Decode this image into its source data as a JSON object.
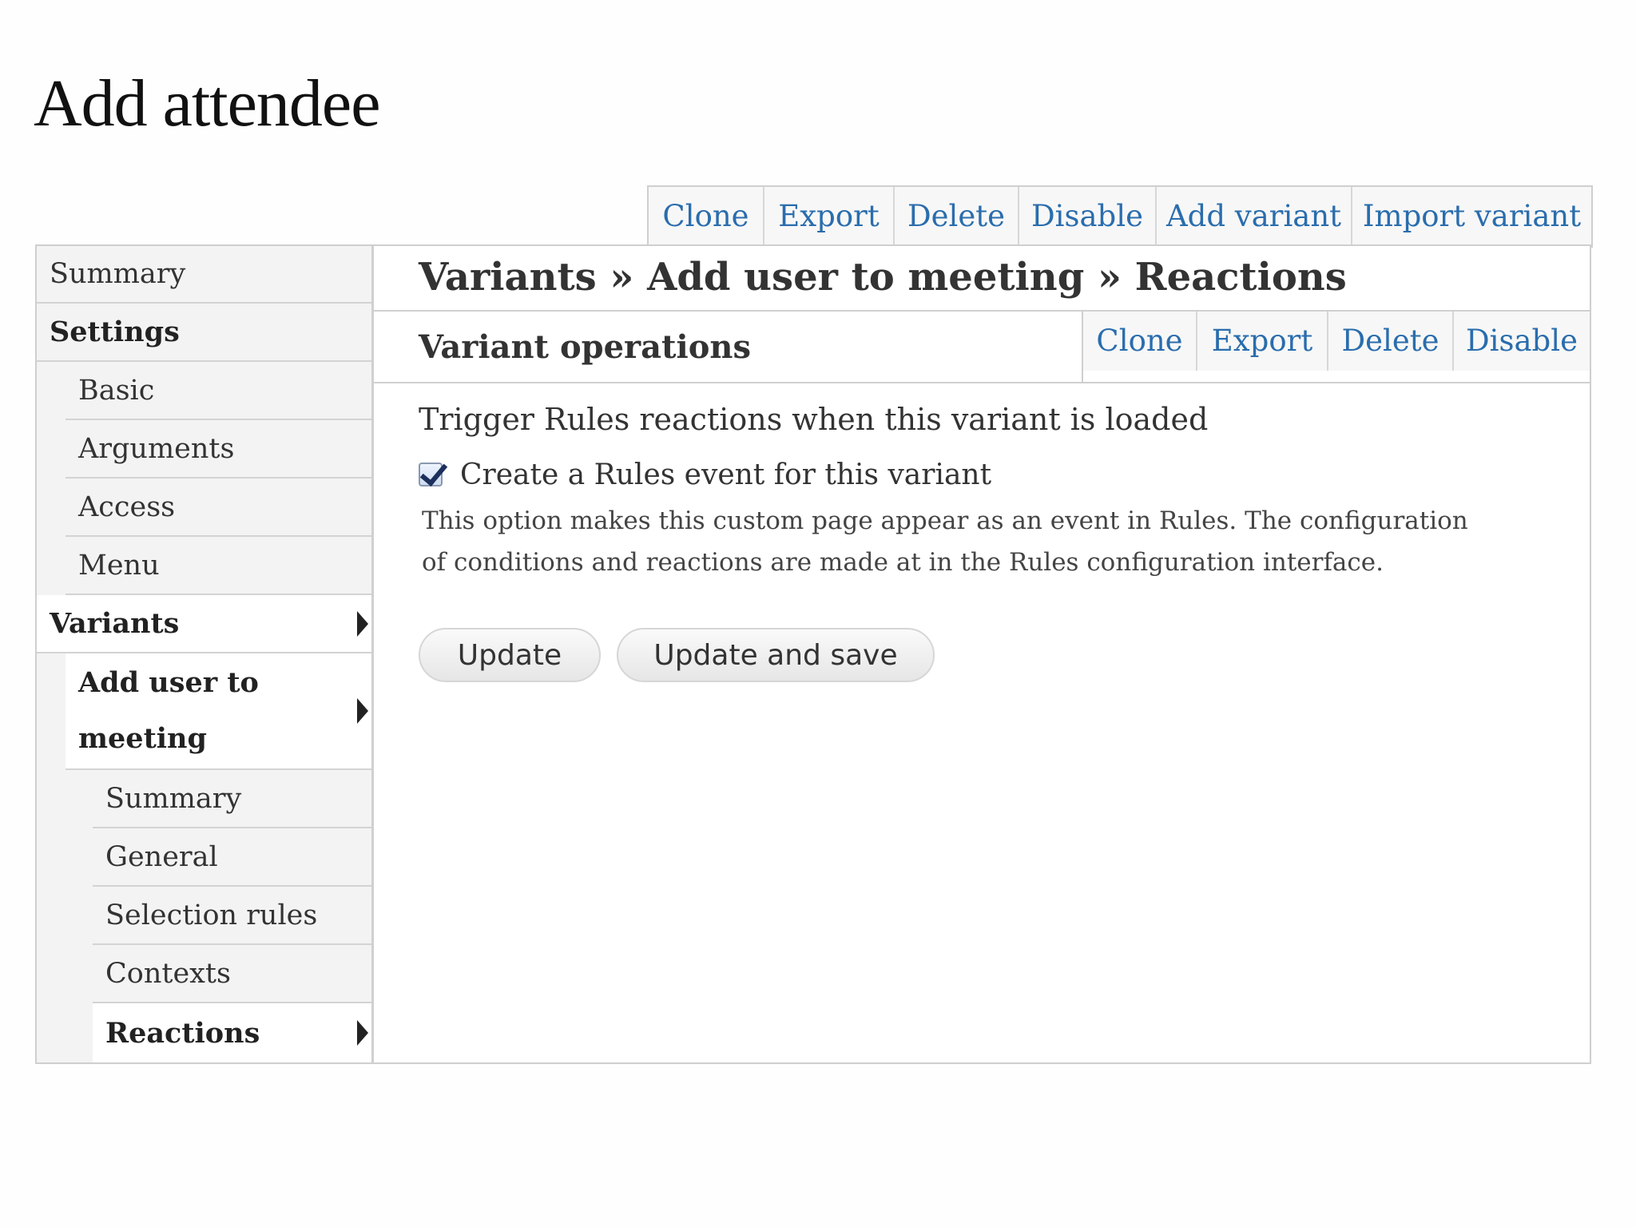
{
  "page": {
    "title": "Add attendee"
  },
  "page_operations": [
    "Clone",
    "Export",
    "Delete",
    "Disable",
    "Add variant",
    "Import variant"
  ],
  "sidebar": {
    "summary": "Summary",
    "settings": "Settings",
    "basic": "Basic",
    "arguments": "Arguments",
    "access": "Access",
    "menu": "Menu",
    "variants": "Variants",
    "variant_name_line1": "Add user to",
    "variant_name_line2": "meeting",
    "variant_summary": "Summary",
    "general": "General",
    "selection_rules": "Selection rules",
    "contexts": "Contexts",
    "reactions": "Reactions"
  },
  "main": {
    "breadcrumb": "Variants » Add user to meeting » Reactions",
    "variant_operations_title": "Variant operations",
    "variant_operations": [
      "Clone",
      "Export",
      "Delete",
      "Disable"
    ],
    "section_title": "Trigger Rules reactions when this variant is loaded",
    "checkbox_label": "Create a Rules event for this variant",
    "checkbox_checked": true,
    "description": "This option makes this custom page appear as an event in Rules. The configuration of conditions and reactions are made at in the Rules configuration interface.",
    "update_button": "Update",
    "update_save_button": "Update and save"
  }
}
